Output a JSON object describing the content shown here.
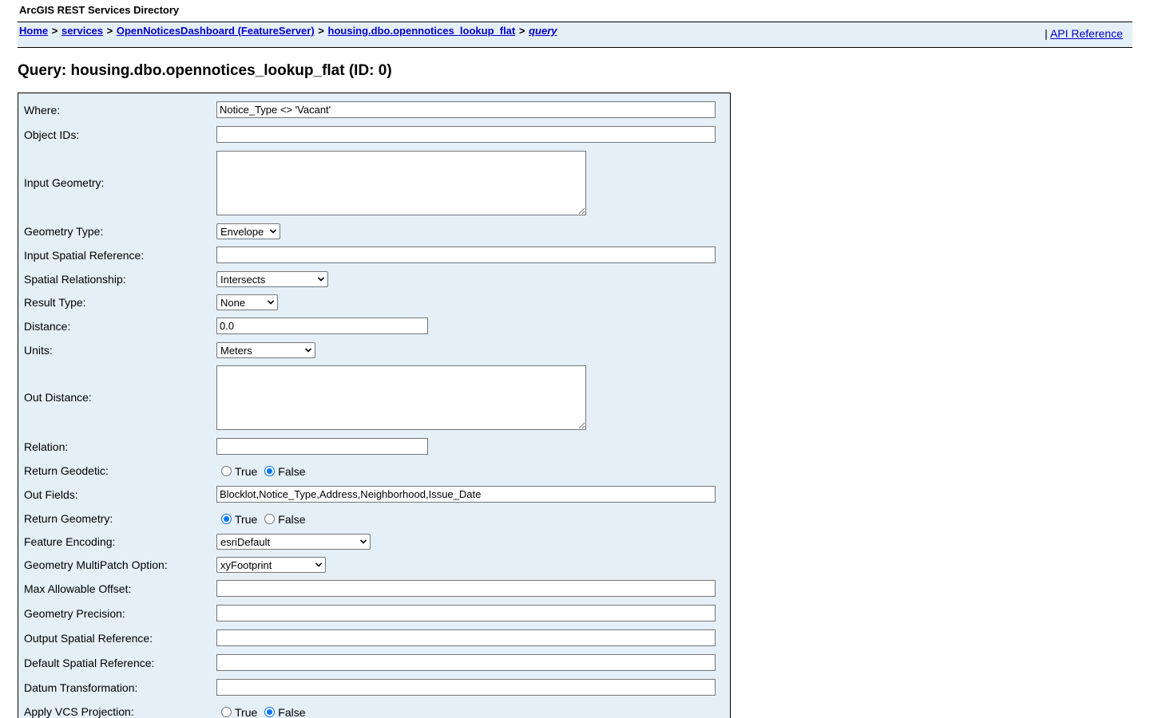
{
  "header": {
    "user_title": "ArcGIS REST Services Directory",
    "breadcrumbs": [
      {
        "label": "Home"
      },
      {
        "label": "services"
      },
      {
        "label": "OpenNoticesDashboard (FeatureServer)"
      },
      {
        "label": "housing.dbo.opennotices_lookup_flat"
      },
      {
        "label": "query"
      }
    ],
    "separator": ">",
    "help_prefix": "|",
    "help_link": "API Reference"
  },
  "page": {
    "title": "Query: housing.dbo.opennotices_lookup_flat (ID: 0)"
  },
  "form": {
    "where": {
      "label": "Where:",
      "value": "Notice_Type <> 'Vacant'"
    },
    "object_ids": {
      "label": "Object IDs:",
      "value": ""
    },
    "input_geometry": {
      "label": "Input Geometry:",
      "value": ""
    },
    "geometry_type": {
      "label": "Geometry Type:",
      "selected": "Envelope"
    },
    "input_spatial_reference": {
      "label": "Input Spatial Reference:",
      "value": ""
    },
    "spatial_relationship": {
      "label": "Spatial Relationship:",
      "selected": "Intersects"
    },
    "result_type": {
      "label": "Result Type:",
      "selected": "None"
    },
    "distance": {
      "label": "Distance:",
      "value": "0.0"
    },
    "units": {
      "label": "Units:",
      "selected": "Meters"
    },
    "out_distance": {
      "label": "Out Distance:",
      "value": ""
    },
    "relation": {
      "label": "Relation:",
      "value": ""
    },
    "return_geodetic": {
      "label": "Return Geodetic:",
      "option_true": "True",
      "option_false": "False",
      "selected": "False"
    },
    "out_fields": {
      "label": "Out Fields:",
      "value": "Blocklot,Notice_Type,Address,Neighborhood,Issue_Date"
    },
    "return_geometry": {
      "label": "Return Geometry:",
      "option_true": "True",
      "option_false": "False",
      "selected": "True"
    },
    "feature_encoding": {
      "label": "Feature Encoding:",
      "selected": "esriDefault"
    },
    "multipatch_option": {
      "label": "Geometry MultiPatch Option:",
      "selected": "xyFootprint"
    },
    "max_allowable_offset": {
      "label": "Max Allowable Offset:",
      "value": ""
    },
    "geometry_precision": {
      "label": "Geometry Precision:",
      "value": ""
    },
    "output_spatial_reference": {
      "label": "Output Spatial Reference:",
      "value": ""
    },
    "default_spatial_reference": {
      "label": "Default Spatial Reference:",
      "value": ""
    },
    "datum_transformation": {
      "label": "Datum Transformation:",
      "value": ""
    },
    "apply_vcs_projection": {
      "label": "Apply VCS Projection:",
      "option_true": "True",
      "option_false": "False",
      "selected": "False"
    }
  },
  "icons": {
    "select_arrow": "chevron-down-icon"
  },
  "colors": {
    "panel_background": "#e5eff7",
    "link": "#0000cc",
    "radio_accent": "#0075ff"
  }
}
